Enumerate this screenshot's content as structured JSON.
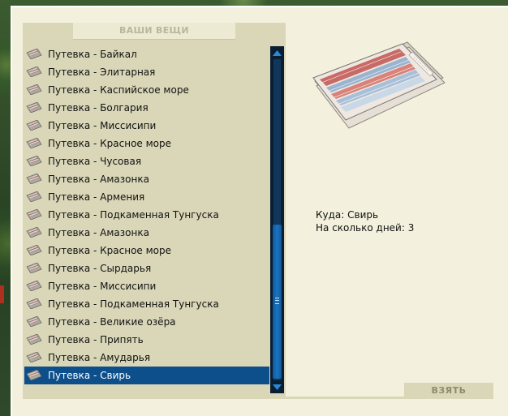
{
  "panel": {
    "title": "ВАШИ ВЕЩИ"
  },
  "items": [
    {
      "label": "Путевка - Байкал"
    },
    {
      "label": "Путевка - Элитарная"
    },
    {
      "label": "Путевка - Каспийское море"
    },
    {
      "label": "Путевка - Болгария"
    },
    {
      "label": "Путевка - Миссисипи"
    },
    {
      "label": "Путевка - Красное море"
    },
    {
      "label": "Путевка - Чусовая"
    },
    {
      "label": "Путевка - Амазонка"
    },
    {
      "label": "Путевка - Армения"
    },
    {
      "label": "Путевка - Подкаменная Тунгуска"
    },
    {
      "label": "Путевка - Амазонка"
    },
    {
      "label": "Путевка - Красное море"
    },
    {
      "label": "Путевка - Сырдарья"
    },
    {
      "label": "Путевка - Миссисипи"
    },
    {
      "label": "Путевка - Подкаменная Тунгуска"
    },
    {
      "label": "Путевка - Великие озёра"
    },
    {
      "label": "Путевка - Припять"
    },
    {
      "label": "Путевка - Амударья"
    },
    {
      "label": "Путевка - Свирь"
    }
  ],
  "selected_index": 18,
  "details": {
    "destination_label": "Куда:",
    "destination_value": "Свирь",
    "days_label": "На сколько дней:",
    "days_value": "3"
  },
  "actions": {
    "take_label": "ВЗЯТЬ"
  },
  "icons": {
    "item_icon": "ticket-icon",
    "preview_icon": "ticket-booklet-icon",
    "scroll_up": "arrow-up-icon",
    "scroll_down": "arrow-down-icon"
  },
  "colors": {
    "selection": "#0d4f8a",
    "panel": "#d9d7b8",
    "window": "#f3f1dd",
    "scrollbar": "#0a1e33"
  }
}
